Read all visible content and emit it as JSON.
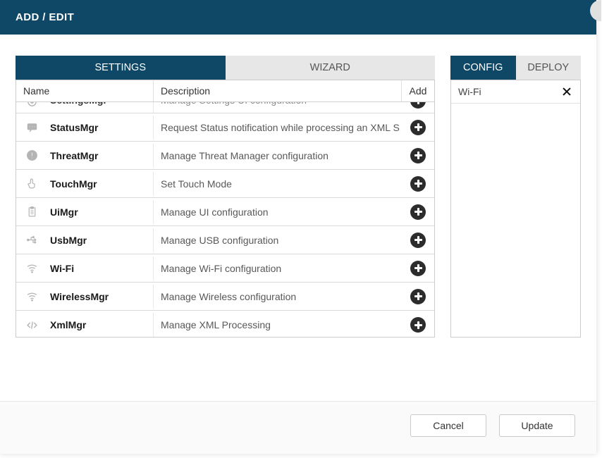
{
  "modal": {
    "title": "ADD / EDIT"
  },
  "left": {
    "tabs": {
      "settings": "SETTINGS",
      "wizard": "WIZARD",
      "active": "settings"
    },
    "columns": {
      "name": "Name",
      "description": "Description",
      "add": "Add"
    },
    "partial_row": {
      "name": "SettingsMgr",
      "description": "Manage Settings UI configuration"
    },
    "rows": [
      {
        "icon": "chat-icon",
        "name": "StatusMgr",
        "description": "Request Status notification while processing an XML S"
      },
      {
        "icon": "alert-icon",
        "name": "ThreatMgr",
        "description": "Manage Threat Manager configuration"
      },
      {
        "icon": "touch-icon",
        "name": "TouchMgr",
        "description": "Set Touch Mode"
      },
      {
        "icon": "clipboard-icon",
        "name": "UiMgr",
        "description": "Manage UI configuration"
      },
      {
        "icon": "usb-icon",
        "name": "UsbMgr",
        "description": "Manage USB configuration"
      },
      {
        "icon": "wifi-icon",
        "name": "Wi-Fi",
        "description": "Manage Wi-Fi configuration"
      },
      {
        "icon": "wifi-icon",
        "name": "WirelessMgr",
        "description": "Manage Wireless configuration"
      },
      {
        "icon": "code-icon",
        "name": "XmlMgr",
        "description": "Manage XML Processing"
      }
    ]
  },
  "right": {
    "tabs": {
      "config": "CONFIG",
      "deploy": "DEPLOY",
      "active": "config"
    },
    "items": [
      {
        "label": "Wi-Fi"
      }
    ]
  },
  "footer": {
    "cancel": "Cancel",
    "update": "Update"
  }
}
